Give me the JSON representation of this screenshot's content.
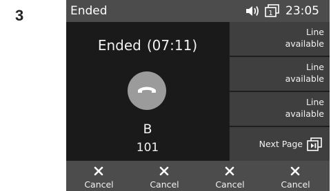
{
  "step": {
    "number": "3"
  },
  "status_bar": {
    "title": "Ended",
    "time": "23:05",
    "line_number": "1"
  },
  "call": {
    "status": "Ended",
    "duration": "(07:11)",
    "contact_name": "B",
    "contact_number": "101"
  },
  "line_keys": [
    {
      "line1": "Line",
      "line2": "available"
    },
    {
      "line1": "Line",
      "line2": "available"
    },
    {
      "line1": "Line",
      "line2": "available"
    }
  ],
  "next_page": {
    "label": "Next Page"
  },
  "softkeys": [
    {
      "label": "Cancel"
    },
    {
      "label": "Cancel"
    },
    {
      "label": "Cancel"
    },
    {
      "label": "Cancel"
    }
  ],
  "icons": {
    "speaker": "speaker-icon",
    "line_status": "line-status-icon",
    "end_call": "phone-hangup-icon",
    "next_page": "next-page-icon",
    "cancel": "close-icon"
  },
  "colors": {
    "screen_background": "#1e1e1e",
    "bar_background": "#4c4c4c",
    "line_key_background": "#3f3f3f",
    "end_call_button": "#9b9b9b",
    "text": "#f2f2f2"
  }
}
